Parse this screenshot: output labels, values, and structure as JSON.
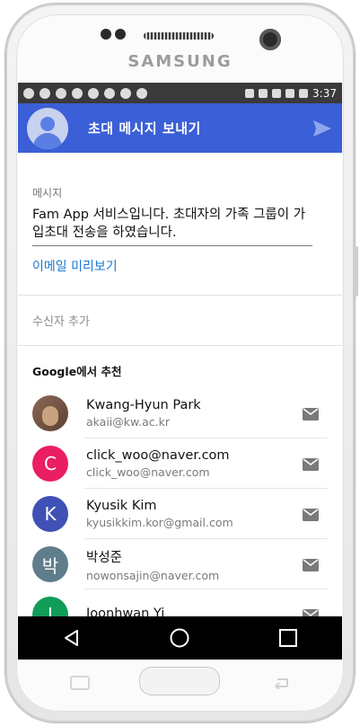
{
  "device": {
    "brand": "SAMSUNG"
  },
  "status_bar": {
    "time": "3:37"
  },
  "app_bar": {
    "title": "초대 메시지 보내기"
  },
  "compose": {
    "message_label": "메시지",
    "message_text": "Fam App 서비스입니다. 초대자의 가족 그룹이 가입초대 전송을 하였습니다.",
    "preview_link": "이메일 미리보기",
    "add_recipients": "수신자 추가"
  },
  "suggestions": {
    "header": "Google에서 추천",
    "contacts": [
      {
        "name": "Kwang-Hyun Park",
        "email": "akaii@kw.ac.kr",
        "avatar": "photo",
        "color": "#7a5a45"
      },
      {
        "name": "click_woo@naver.com",
        "email": "click_woo@naver.com",
        "avatar": "C",
        "color": "#e91e63"
      },
      {
        "name": "Kyusik Kim",
        "email": "kyusikkim.kor@gmail.com",
        "avatar": "K",
        "color": "#3f51b5"
      },
      {
        "name": "박성준",
        "email": "nowonsajin@naver.com",
        "avatar": "박",
        "color": "#607d8b"
      },
      {
        "name": "Joonhwan Yi",
        "email": "",
        "avatar": "J",
        "color": "#0f9d58"
      }
    ]
  },
  "colors": {
    "app_bar": "#3b5fd6",
    "link": "#1976d2"
  },
  "icons": {
    "send": "send-icon",
    "mail": "mail-icon",
    "back": "back-icon",
    "home": "home-icon",
    "recents": "recents-icon"
  }
}
